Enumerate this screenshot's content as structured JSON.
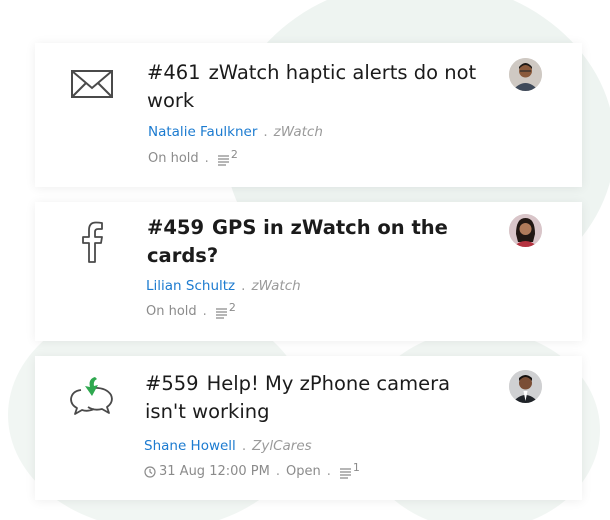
{
  "tickets": [
    {
      "channel_icon": "mail-icon",
      "number": "#461",
      "title": "zWatch haptic alerts do not work",
      "contact": "Natalie Faulkner",
      "product": "zWatch",
      "status": "On hold",
      "thread_count": "2"
    },
    {
      "channel_icon": "facebook-icon",
      "number": "#459",
      "title": "GPS in zWatch on the cards?",
      "contact": "Lilian Schultz",
      "product": "zWatch",
      "status": "On hold",
      "thread_count": "2"
    },
    {
      "channel_icon": "chat-incoming-icon",
      "number": "#559",
      "title": "Help! My zPhone camera isn't working",
      "contact": "Shane Howell",
      "product": "ZylCares",
      "due": "31 Aug 12:00 PM",
      "status": "Open",
      "thread_count": "1"
    }
  ],
  "colors": {
    "contact_link": "#1c7bd0",
    "muted_text": "#8b8b8b",
    "title_text": "#1b1b1b",
    "chat_arrow": "#2fa84f",
    "background_blob": "#eef4f1"
  }
}
